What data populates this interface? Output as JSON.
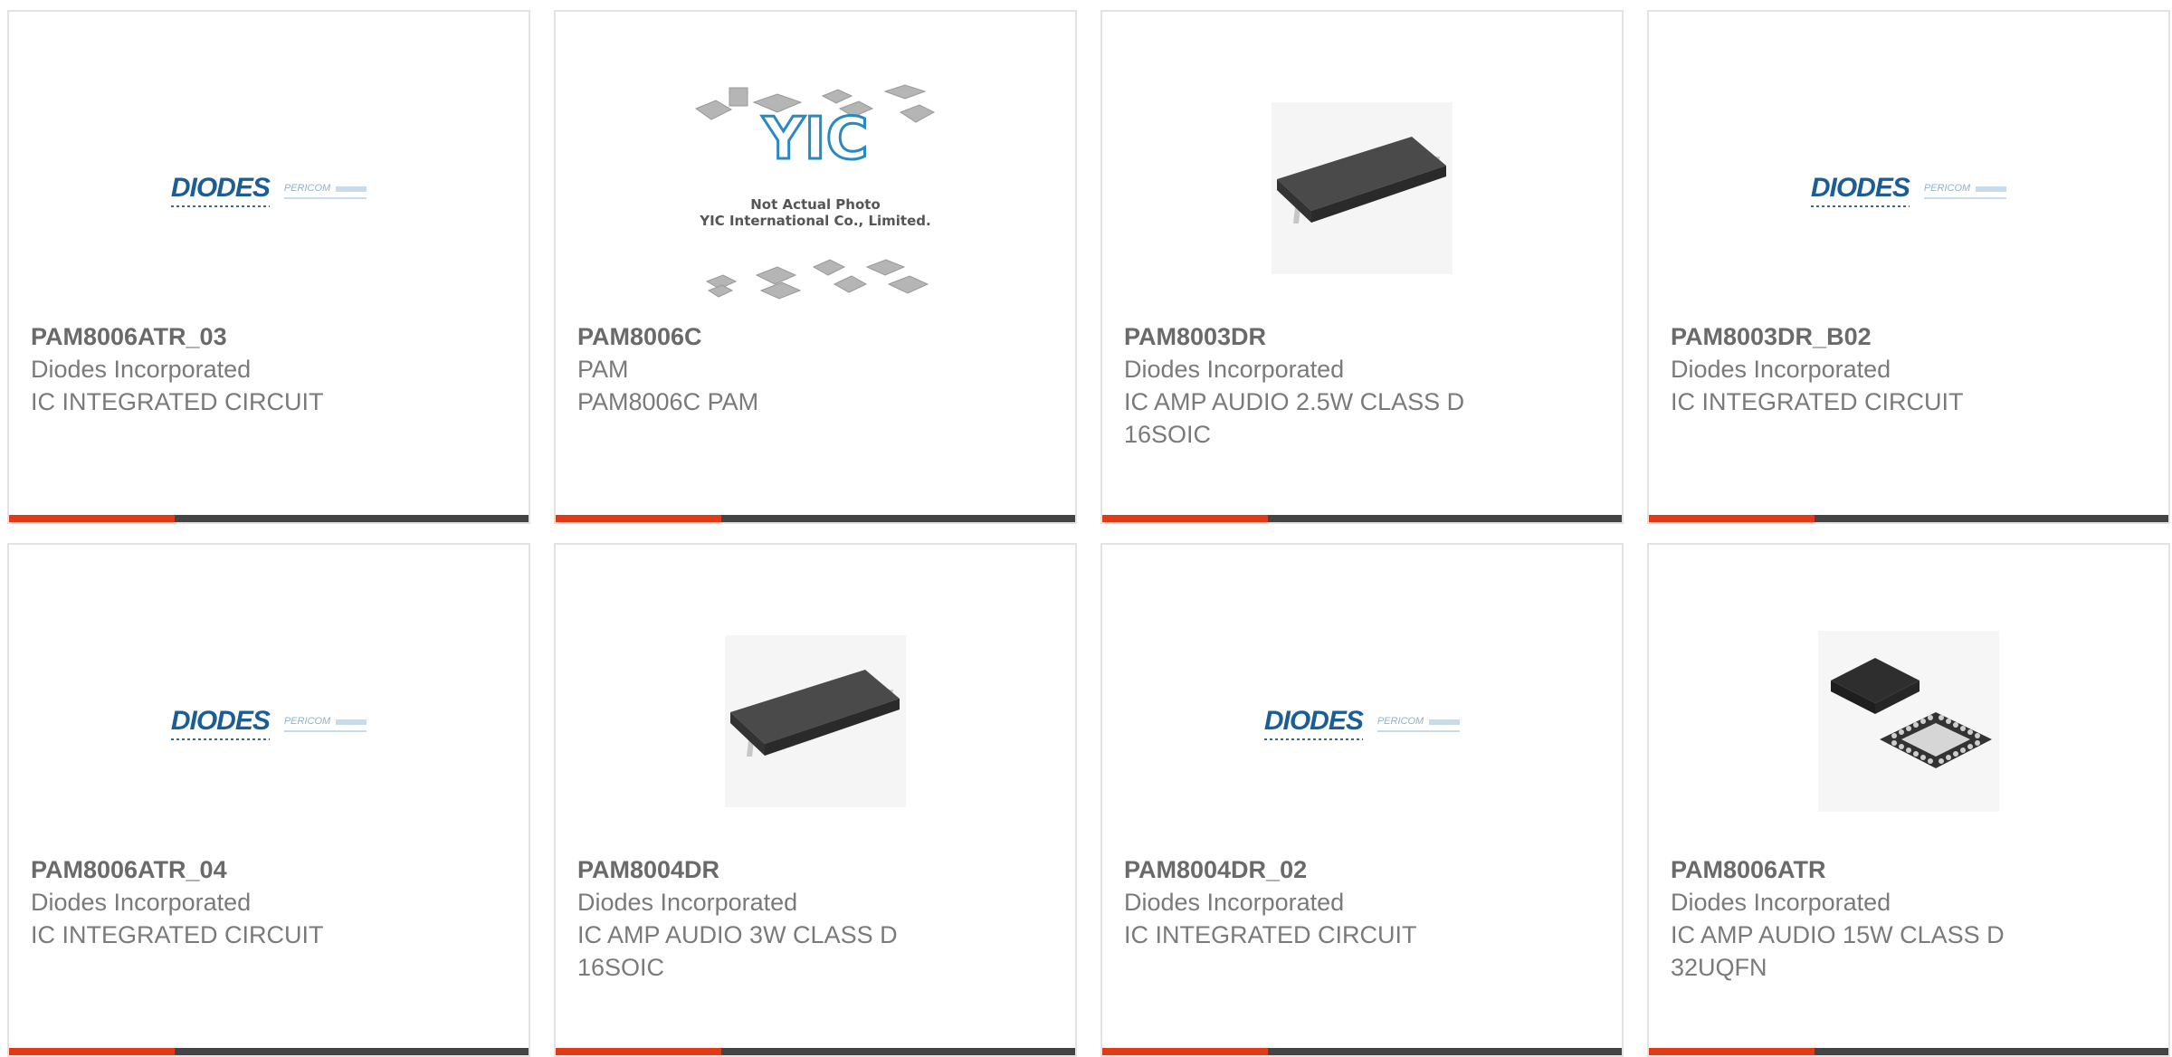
{
  "colors": {
    "accent_bar": "#e03a16",
    "dark_bar": "#444444",
    "logo_blue": "#1c5d96",
    "logo_light": "#8fb2cf"
  },
  "products": [
    {
      "part_number": "PAM8006ATR_03",
      "manufacturer": "Diodes Incorporated",
      "description": "IC INTEGRATED CIRCUIT",
      "image": "diodes-pericom-logo"
    },
    {
      "part_number": "PAM8006C",
      "manufacturer": "PAM",
      "description": "PAM8006C PAM",
      "image": "yic-not-actual-photo"
    },
    {
      "part_number": "PAM8003DR",
      "manufacturer": "Diodes Incorporated",
      "description": "IC AMP AUDIO 2.5W CLASS D 16SOIC",
      "image": "soic-16-chip"
    },
    {
      "part_number": "PAM8003DR_B02",
      "manufacturer": "Diodes Incorporated",
      "description": "IC INTEGRATED CIRCUIT",
      "image": "diodes-pericom-logo"
    },
    {
      "part_number": "PAM8006ATR_04",
      "manufacturer": "Diodes Incorporated",
      "description": "IC INTEGRATED CIRCUIT",
      "image": "diodes-pericom-logo"
    },
    {
      "part_number": "PAM8004DR",
      "manufacturer": "Diodes Incorporated",
      "description": "IC AMP AUDIO 3W CLASS D 16SOIC",
      "image": "soic-16-chip"
    },
    {
      "part_number": "PAM8004DR_02",
      "manufacturer": "Diodes Incorporated",
      "description": "IC INTEGRATED CIRCUIT",
      "image": "diodes-pericom-logo"
    },
    {
      "part_number": "PAM8006ATR",
      "manufacturer": "Diodes Incorporated",
      "description": "IC AMP AUDIO 15W CLASS D 32UQFN",
      "image": "uqfn-32-chip"
    }
  ],
  "logo": {
    "main": "DIODES",
    "sub": "PERICOM"
  },
  "yic": {
    "brand": "YIC",
    "line1": "Not Actual Photo",
    "line2": "YIC International Co., Limited."
  }
}
